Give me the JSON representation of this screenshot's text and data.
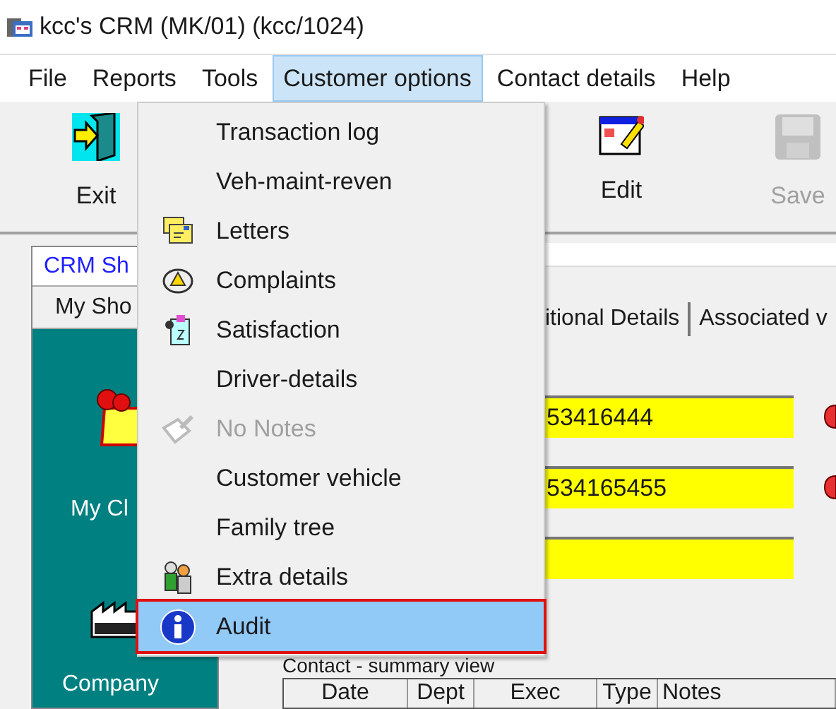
{
  "window": {
    "title": "kcc's CRM (MK/01) (kcc/1024)"
  },
  "menu_bar": [
    {
      "label": "File",
      "selected": false
    },
    {
      "label": "Reports",
      "selected": false
    },
    {
      "label": "Tools",
      "selected": false
    },
    {
      "label": "Customer options",
      "selected": true
    },
    {
      "label": "Contact details",
      "selected": false
    },
    {
      "label": "Help",
      "selected": false
    }
  ],
  "toolbar": [
    {
      "label": "Exit",
      "disabled": false
    },
    {
      "label": "Edit",
      "disabled": false
    },
    {
      "label": "Save",
      "disabled": true
    }
  ],
  "left_panel": {
    "header": "CRM Sh",
    "tab": "My Sho",
    "items": [
      "My Cl",
      "Company"
    ]
  },
  "detail_tabs": [
    "itional Details",
    "Associated v"
  ],
  "fields": [
    {
      "kind": "text",
      "value": "53416444"
    },
    {
      "kind": "text",
      "value": "534165455"
    },
    {
      "kind": "blank"
    }
  ],
  "summary": {
    "title": "Contact - summary view",
    "columns": [
      "Date",
      "Dept",
      "Exec",
      "Type",
      "Notes"
    ]
  },
  "dropdown": [
    {
      "label": "Transaction log",
      "disabled": false,
      "selected": false
    },
    {
      "label": "Veh-maint-reven",
      "disabled": false,
      "selected": false
    },
    {
      "label": "Letters",
      "disabled": false,
      "selected": false
    },
    {
      "label": "Complaints",
      "disabled": false,
      "selected": false
    },
    {
      "label": "Satisfaction",
      "disabled": false,
      "selected": false
    },
    {
      "label": "Driver-details",
      "disabled": false,
      "selected": false
    },
    {
      "label": "No Notes",
      "disabled": true,
      "selected": false
    },
    {
      "label": "Customer vehicle",
      "disabled": false,
      "selected": false
    },
    {
      "label": "Family tree",
      "disabled": false,
      "selected": false
    },
    {
      "label": "Extra details",
      "disabled": false,
      "selected": false
    },
    {
      "label": "Audit",
      "disabled": false,
      "selected": true
    }
  ]
}
